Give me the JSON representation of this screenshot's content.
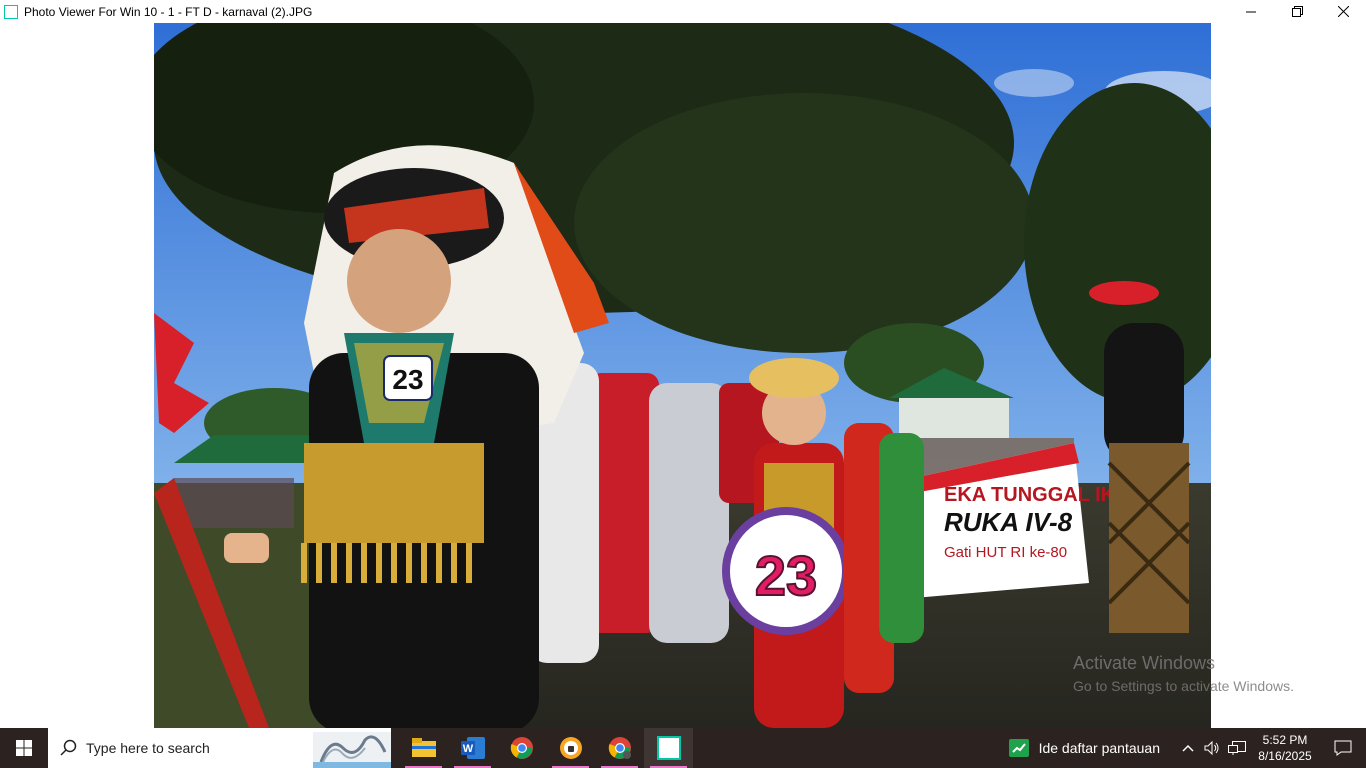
{
  "window": {
    "title": "Photo Viewer For Win 10 - 1 - FT  D - karnaval (2).JPG",
    "minimize_icon": "minimize-icon",
    "restore_icon": "restore-icon",
    "close_icon": "close-icon"
  },
  "photo": {
    "badge_child_number": "23",
    "sign_number": "23",
    "banner_line1": "EKA TUNGGAL IKA",
    "banner_line2": "RUKA IV-8",
    "banner_line3": "Gati HUT RI ke-80"
  },
  "watermark": {
    "line1": "Activate Windows",
    "line2": "Go to Settings to activate Windows."
  },
  "taskbar": {
    "search_placeholder": "Type here to search",
    "apps": [
      "file-explorer-icon",
      "word-icon",
      "chrome-icon",
      "vpn-icon",
      "chrome-profile-icon",
      "photo-viewer-icon"
    ],
    "notification_label": "Ide daftar pantauan",
    "time": "5:52 PM",
    "date": "8/16/2025"
  },
  "colors": {
    "taskbar_bg": "#2c2320",
    "accent_underline": "#e879c9",
    "app_icon_border": "#00c9a7"
  }
}
